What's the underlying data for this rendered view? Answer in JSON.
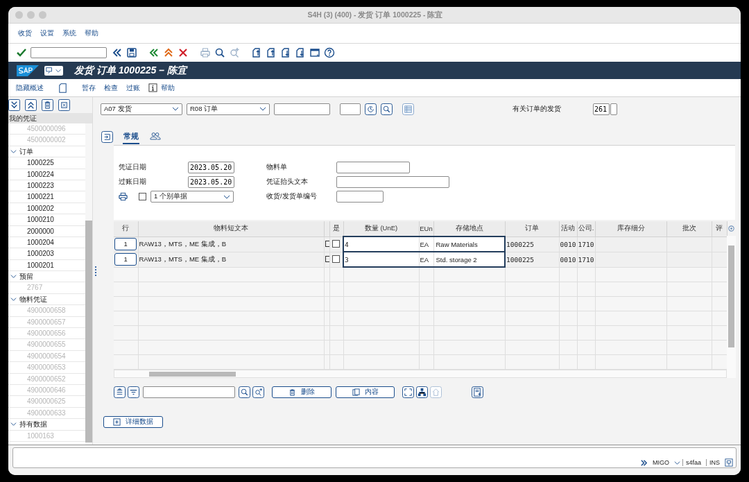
{
  "window": {
    "title": "S4H (3) (400) - 发货 订单 1000225 - 陈宜"
  },
  "menu": [
    "收货",
    "设置",
    "系统",
    "帮助"
  ],
  "screen_title": "发货 订单 1000225 – 陈宜",
  "app_toolbar": [
    "隐藏概述",
    "暂存",
    "检查",
    "过账",
    "帮助"
  ],
  "sidebar": {
    "title": "我的凭证",
    "items": [
      {
        "label": "4500000096",
        "disabled": true
      },
      {
        "label": "4500000002",
        "disabled": true
      },
      {
        "label": "订单",
        "expanded": true,
        "children": [
          {
            "label": "1000225",
            "disabled": false
          },
          {
            "label": "1000224",
            "disabled": false
          },
          {
            "label": "1000223",
            "disabled": false
          },
          {
            "label": "1000221",
            "disabled": false
          },
          {
            "label": "1000202",
            "disabled": false
          },
          {
            "label": "1000210",
            "disabled": false
          },
          {
            "label": "2000000",
            "disabled": false
          },
          {
            "label": "1000204",
            "disabled": false
          },
          {
            "label": "1000203",
            "disabled": false
          },
          {
            "label": "1000201",
            "disabled": false
          }
        ]
      },
      {
        "label": "预留",
        "expanded": true,
        "children": [
          {
            "label": "2767",
            "disabled": true
          }
        ]
      },
      {
        "label": "物料凭证",
        "expanded": true,
        "children": [
          {
            "label": "4900000658",
            "disabled": true
          },
          {
            "label": "4900000657",
            "disabled": true
          },
          {
            "label": "4900000656",
            "disabled": true
          },
          {
            "label": "4900000655",
            "disabled": true
          },
          {
            "label": "4900000654",
            "disabled": true
          },
          {
            "label": "4900000653",
            "disabled": true
          },
          {
            "label": "4900000652",
            "disabled": true
          },
          {
            "label": "4900000646",
            "disabled": true
          },
          {
            "label": "4900000625",
            "disabled": true
          },
          {
            "label": "4900000633",
            "disabled": true
          }
        ]
      },
      {
        "label": "持有数据",
        "expanded": true,
        "children": [
          {
            "label": "1000163",
            "disabled": true
          }
        ]
      }
    ]
  },
  "selectors": {
    "action": "A07 发货",
    "reference": "R08 订单",
    "movement_label": "有关订单的发货",
    "movement_type": "261"
  },
  "tabs": [
    {
      "kind": "text",
      "label": "常规",
      "selected": true
    },
    {
      "kind": "icon",
      "selected": false
    }
  ],
  "header_fields": {
    "document_date_label": "凭证日期",
    "document_date": "2023.05.20",
    "posting_date_label": "过账日期",
    "posting_date": "2023.05.20",
    "print_checked": false,
    "print_option": "1 个别单据",
    "bill_label": "物料单",
    "header_text_label": "凭证抬头文本",
    "slip_label": "收货/发货单编号"
  },
  "table": {
    "columns": [
      "行",
      "物料短文本",
      "",
      "是",
      "数量 (UnE)",
      "EUn",
      "存储地点",
      "订单",
      "活动",
      "公司.",
      "库存细分",
      "批次",
      "评"
    ],
    "rows": [
      {
        "line": "1",
        "text": "RAW13，MTS，ME 集成，B",
        "checked": false,
        "quantity": "4",
        "unit": "EA",
        "location": "Raw Materials",
        "order": "1000225",
        "activity": "0010",
        "company": "1710"
      },
      {
        "line": "1",
        "text": "RAW13，MTS，ME 集成，B",
        "checked": false,
        "quantity": "3",
        "unit": "EA",
        "location": "Std. storage 2",
        "order": "1000225",
        "activity": "0010",
        "company": "1710"
      }
    ]
  },
  "table_buttons": [
    "删除",
    "内容"
  ],
  "detail_button": "详细数据",
  "status_bar": {
    "transaction": "MIGO",
    "system": "s4faa",
    "mode": "INS"
  }
}
